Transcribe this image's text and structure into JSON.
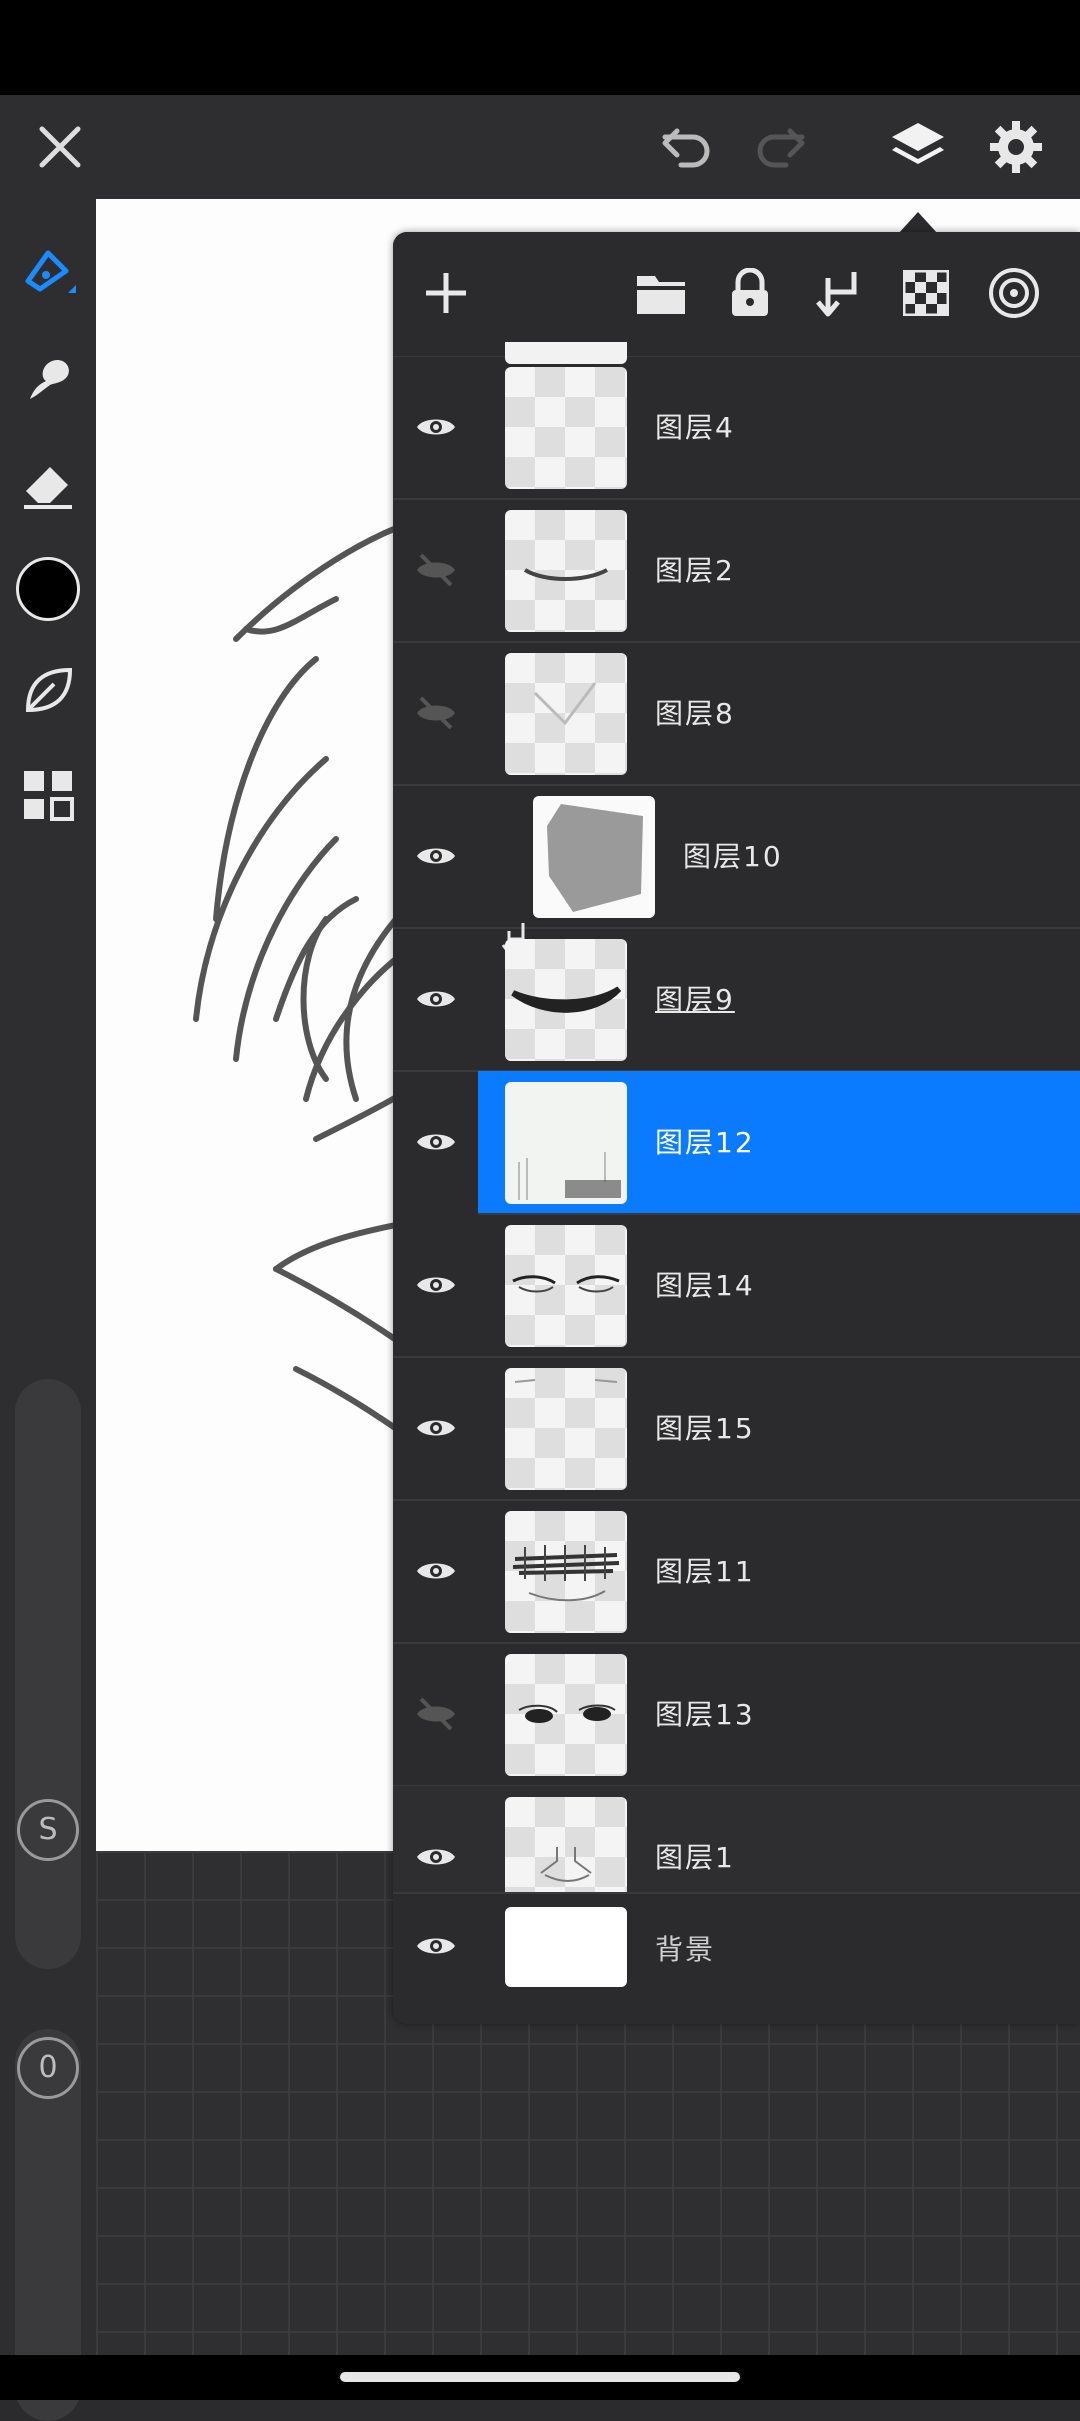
{
  "toolbar": {
    "close_icon": "close-icon",
    "undo_icon": "undo-icon",
    "redo_icon": "redo-icon",
    "layers_icon": "layers-icon",
    "settings_icon": "gear-icon"
  },
  "left_tools": [
    "brush-icon",
    "smudge-icon",
    "eraser-icon",
    "color-swatch",
    "leaf-icon",
    "grid-icon"
  ],
  "slider_labels": {
    "size": "S",
    "opacity": "0"
  },
  "layer_panel": {
    "toolbar_icons": [
      "add-icon",
      "folder-icon",
      "lock-icon",
      "merge-down-icon",
      "transparency-icon",
      "target-icon"
    ],
    "layers": [
      {
        "name": "图层4",
        "visible": true
      },
      {
        "name": "图层2",
        "visible": false
      },
      {
        "name": "图层8",
        "visible": false
      },
      {
        "name": "图层10",
        "visible": true,
        "clipped": true
      },
      {
        "name": "图层9",
        "visible": true
      },
      {
        "name": "图层12",
        "visible": true,
        "selected": true
      },
      {
        "name": "图层14",
        "visible": true
      },
      {
        "name": "图层15",
        "visible": true
      },
      {
        "name": "图层11",
        "visible": true
      },
      {
        "name": "图层13",
        "visible": false
      },
      {
        "name": "图层1",
        "visible": true
      },
      {
        "name": "背景",
        "visible": true
      }
    ]
  },
  "colors": {
    "accent": "#0a7bff",
    "current_color": "#000000"
  }
}
